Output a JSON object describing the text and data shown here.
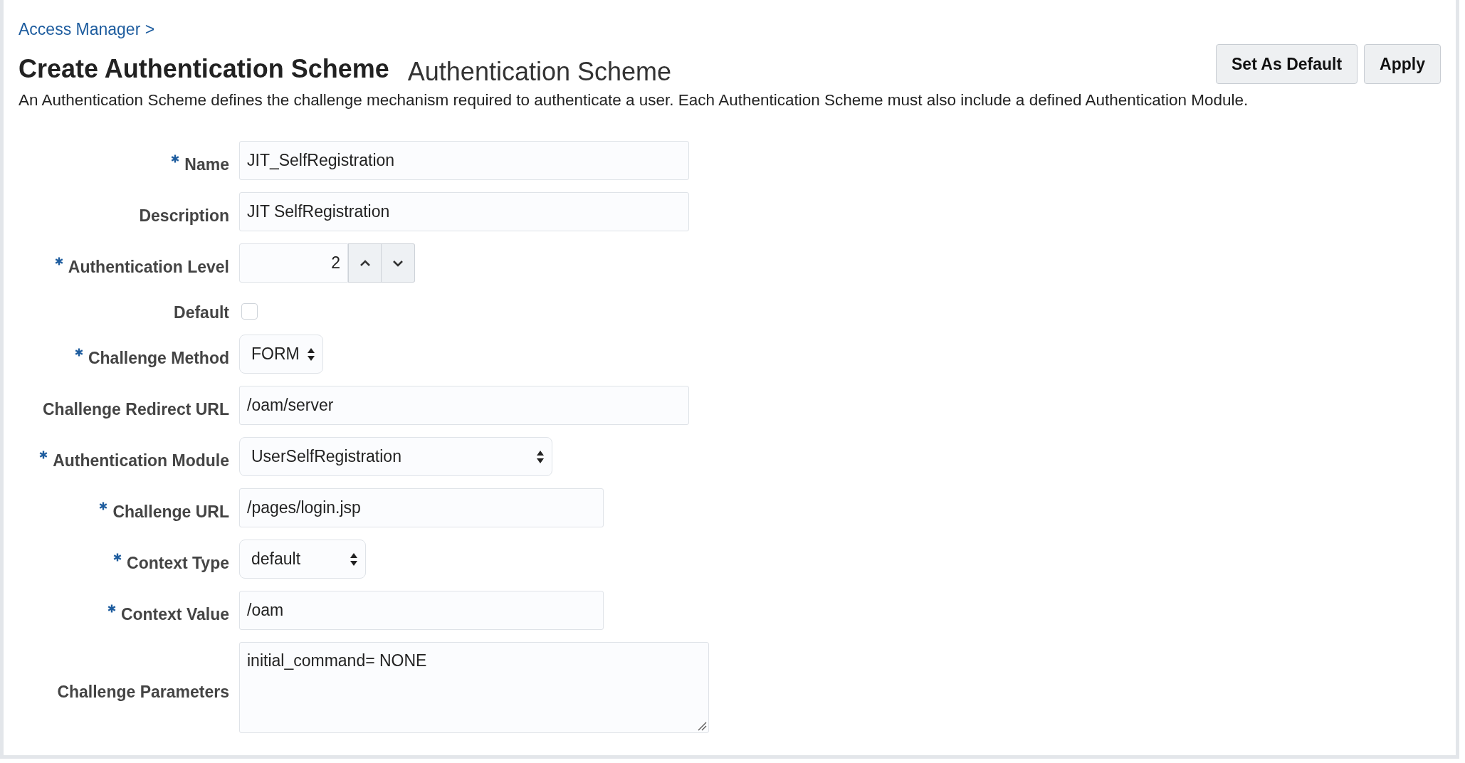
{
  "breadcrumb": "Access Manager >",
  "title": "Create Authentication Scheme",
  "subtitle": "Authentication Scheme",
  "buttons": [
    "Set As Default",
    "Apply"
  ],
  "description": "An Authentication Scheme defines the challenge mechanism required to authenticate a user. Each Authentication Scheme must also include a defined Authentication Module.",
  "fields": [
    {
      "kind": "text",
      "label": "Name",
      "required": true,
      "value": "JIT_SelfRegistration"
    },
    {
      "kind": "text",
      "label": "Description",
      "required": false,
      "value": "JIT SelfRegistration"
    },
    {
      "kind": "spinner",
      "label": "Authentication Level",
      "required": true,
      "value": "2"
    },
    {
      "kind": "checkbox",
      "label": "Default",
      "required": false,
      "checked": false
    },
    {
      "kind": "select",
      "label": "Challenge Method",
      "required": true,
      "value": "FORM"
    },
    {
      "kind": "text",
      "label": "Challenge Redirect URL",
      "required": false,
      "value": "/oam/server"
    },
    {
      "kind": "select",
      "label": "Authentication Module",
      "required": true,
      "value": "UserSelfRegistration"
    },
    {
      "kind": "text",
      "label": "Challenge URL",
      "required": true,
      "value": "/pages/login.jsp"
    },
    {
      "kind": "select",
      "label": "Context Type",
      "required": true,
      "value": "default"
    },
    {
      "kind": "text",
      "label": "Context Value",
      "required": true,
      "value": "/oam"
    },
    {
      "kind": "textarea",
      "label": "Challenge Parameters",
      "required": false,
      "value": "initial_command= NONE"
    }
  ]
}
